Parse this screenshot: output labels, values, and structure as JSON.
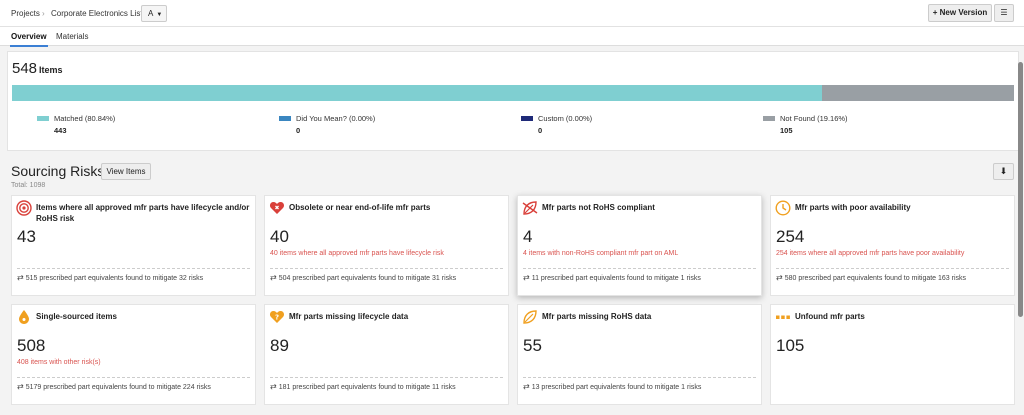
{
  "breadcrumb": {
    "projects": "Projects",
    "list": "Corporate Electronics List"
  },
  "revision": "A",
  "header": {
    "new_version": "New Version"
  },
  "tabs": [
    "Overview",
    "Materials"
  ],
  "summary": {
    "total": "548",
    "label": "Items",
    "legend": [
      {
        "label": "Matched (80.84%)",
        "count": "443",
        "color": "#7fcfd1",
        "pct": 80.84
      },
      {
        "label": "Did You Mean? (0.00%)",
        "count": "0",
        "color": "#3a86c0",
        "pct": 0
      },
      {
        "label": "Custom (0.00%)",
        "count": "0",
        "color": "#1f2a78",
        "pct": 0
      },
      {
        "label": "Not Found (19.16%)",
        "count": "105",
        "color": "#999fa4",
        "pct": 19.16
      }
    ]
  },
  "risks": {
    "title": "Sourcing Risks",
    "view_items": "View Items",
    "total": "Total: 1098",
    "cards": [
      {
        "icon": "target-icon",
        "title": "Items where all approved mfr parts have lifecycle and/or RoHS risk",
        "value": "43",
        "sub": "",
        "footer": "515 prescribed part equivalents found to mitigate 32 risks"
      },
      {
        "icon": "broken-heart-icon",
        "title": "Obsolete or near end-of-life mfr parts",
        "value": "40",
        "sub": "40 items where all approved mfr parts have lifecycle risk",
        "footer": "504 prescribed part equivalents found to mitigate 31 risks"
      },
      {
        "icon": "leaf-crossed-icon",
        "title": "Mfr parts not RoHS compliant",
        "value": "4",
        "sub": "4 items with non-RoHS compliant mfr part on AML",
        "footer": "11 prescribed part equivalents found to mitigate 1 risks"
      },
      {
        "icon": "clock-icon",
        "title": "Mfr parts with poor availability",
        "value": "254",
        "sub": "254 items where all approved mfr parts have poor availability",
        "footer": "580 prescribed part equivalents found to mitigate 163 risks"
      },
      {
        "icon": "drop-icon",
        "title": "Single-sourced items",
        "value": "508",
        "sub": "408 items with other risk(s)",
        "footer": "5179 prescribed part equivalents found to mitigate 224 risks"
      },
      {
        "icon": "heart-question-icon",
        "title": "Mfr parts missing lifecycle data",
        "value": "89",
        "sub": "",
        "footer": "181 prescribed part equivalents found to mitigate 11 risks"
      },
      {
        "icon": "leaf-icon",
        "title": "Mfr parts missing RoHS data",
        "value": "55",
        "sub": "",
        "footer": "13 prescribed part equivalents found to mitigate 1 risks"
      },
      {
        "icon": "dots-icon",
        "title": "Unfound mfr parts",
        "value": "105",
        "sub": "",
        "footer": ""
      }
    ]
  }
}
